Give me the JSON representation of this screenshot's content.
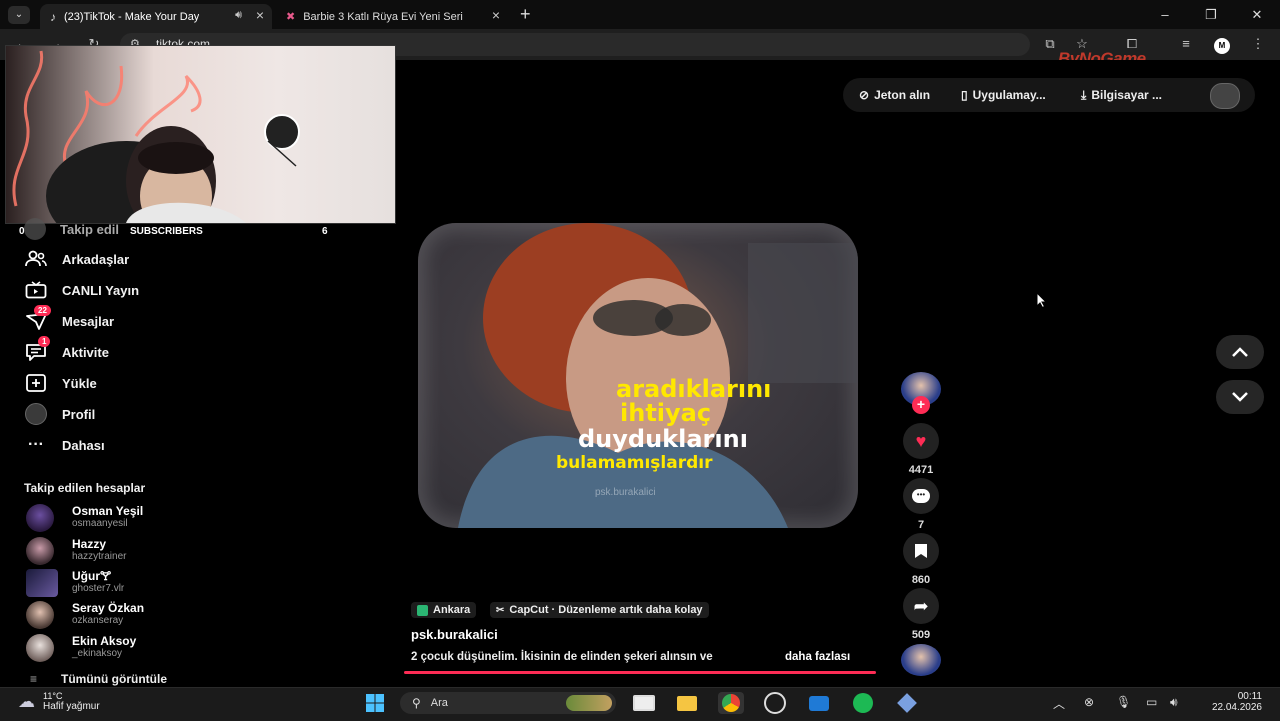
{
  "browser": {
    "tabs": [
      {
        "title": "(23)TikTok - Make Your Day"
      },
      {
        "title": "Barbie 3 Katlı Rüya Evi Yeni Seri"
      }
    ],
    "url": "tiktok.com",
    "window_buttons": {
      "minimize": "–",
      "restore": "❐",
      "close": "✕"
    },
    "new_tab": "+",
    "watermark": "ByNoGame"
  },
  "webcam": {
    "subscribers_left": "0",
    "subscribers_label": "SUBSCRIBERS",
    "subscribers_right": "6"
  },
  "header": {
    "coins": "Jeton alın",
    "app": "Uygulamay...",
    "computer": "Bilgisayar ..."
  },
  "sidebar": {
    "following": "Takip edil",
    "items": [
      {
        "label": "Arkadaşlar",
        "icon": "friends-icon"
      },
      {
        "label": "CANLI Yayın",
        "icon": "live-icon"
      },
      {
        "label": "Mesajlar",
        "icon": "messages-icon",
        "badge": "22"
      },
      {
        "label": "Aktivite",
        "icon": "activity-icon",
        "badge": "1"
      },
      {
        "label": "Yükle",
        "icon": "upload-icon"
      },
      {
        "label": "Profil",
        "icon": "profile-icon"
      },
      {
        "label": "Dahası",
        "icon": "more-icon"
      }
    ],
    "followed_title": "Takip edilen hesaplar",
    "accounts": [
      {
        "name": "Osman Yeşil",
        "handle": "osmaanyesil"
      },
      {
        "name": "Hazzy",
        "handle": "hazzytrainer"
      },
      {
        "name": "Uğur🝖",
        "handle": "ghoster7.vlr"
      },
      {
        "name": "Seray Özkan",
        "handle": "ozkanseray"
      },
      {
        "name": "Ekin Aksoy",
        "handle": "_ekinaksoy"
      }
    ],
    "see_all": "Tümünü görüntüle"
  },
  "video": {
    "captions": [
      "aradıklarını",
      "ihtiyaç",
      "duyduklarını",
      "bulamamışlardır"
    ],
    "watermark": "psk.burakalici",
    "likes": "4471",
    "comments": "7",
    "saves": "860",
    "shares": "509",
    "location": "Ankara",
    "capcut": "CapCut · Düzenleme artık daha kolay",
    "author": "psk.burakalici",
    "description": "2 çocuk düşünelim. İkisinin de elinden şekeri alınsın ve",
    "more": "daha fazlası"
  },
  "taskbar": {
    "temp": "11°C",
    "weather": "Hafif yağmur",
    "search": "Ara",
    "time": "00:11",
    "date": "22.04.2026"
  },
  "colors": {
    "accent": "#fe2c55",
    "caption_yellow": "#ffe800",
    "background": "#000000"
  }
}
